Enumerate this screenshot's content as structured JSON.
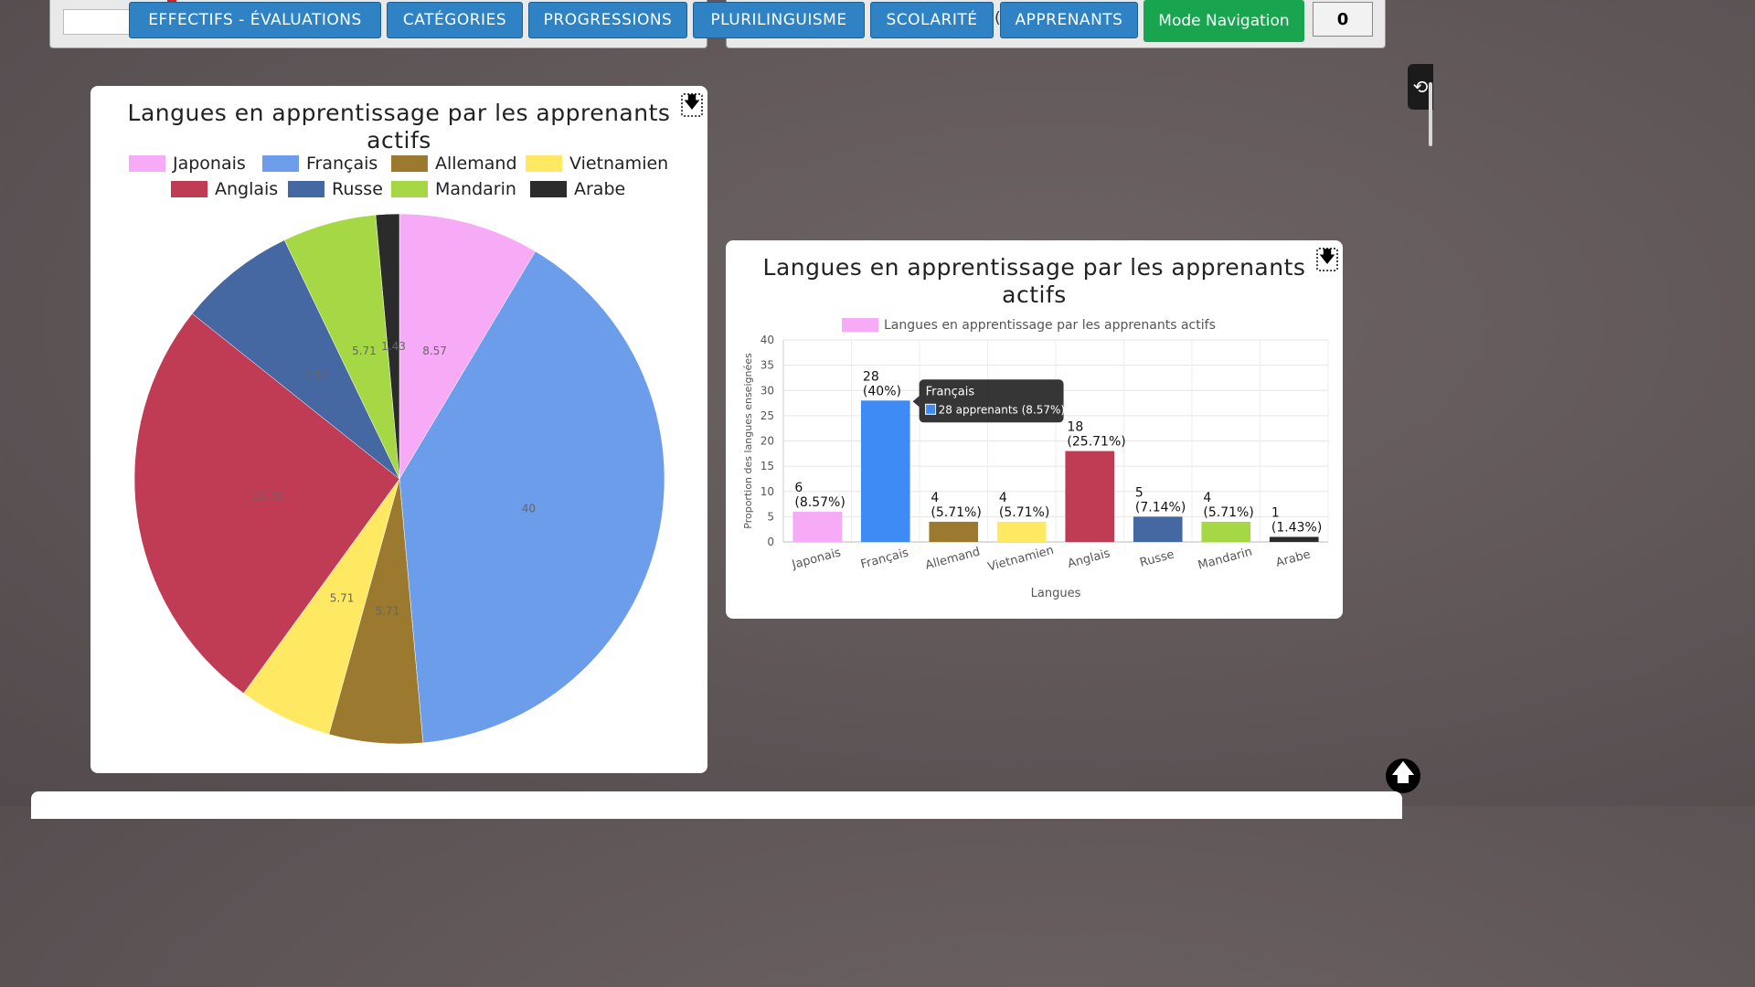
{
  "nav": {
    "buttons": [
      {
        "label": "EFFECTIFS - ÉVALUATIONS"
      },
      {
        "label": "CATÉGORIES"
      },
      {
        "label": "PROGRESSIONS"
      },
      {
        "label": "PLURILINGUISME"
      },
      {
        "label": "SCOLARITÉ"
      },
      {
        "label": "APPRENANTS"
      }
    ],
    "mode_label": "Mode Navigation",
    "counter": "0",
    "paren": "("
  },
  "colors": {
    "nav_blue": "#2f83c4",
    "mode_green": "#19a44f"
  },
  "icons": {
    "download": "download-icon",
    "history": "history-icon",
    "scroll_top": "arrow-up-icon"
  },
  "pie_card": {
    "title_line1": "Langues en apprentissage par les apprenants",
    "title_line2": "actifs"
  },
  "bar_card": {
    "title_line1": "Langues en apprentissage par les apprenants",
    "title_line2": "actifs",
    "legend_label": "Langues en apprentissage par les apprenants actifs",
    "tooltip_title": "Français",
    "tooltip_body": "28 apprenants (8.57%)"
  },
  "chart_data": [
    {
      "type": "pie",
      "title": "Langues en apprentissage par les apprenants actifs",
      "legend": "top",
      "categories": [
        "Japonais",
        "Français",
        "Allemand",
        "Vietnamien",
        "Anglais",
        "Russe",
        "Mandarin",
        "Arabe"
      ],
      "values": [
        8.57,
        40,
        5.71,
        5.71,
        25.71,
        7.14,
        5.71,
        1.43
      ],
      "labels": [
        "8.57",
        "40",
        "5.71",
        "5.71",
        "25.71",
        "7.14",
        "5.71",
        "1.43"
      ],
      "colors": [
        "#f7aaf5",
        "#6c9deb",
        "#9b7a2f",
        "#ffe963",
        "#c03c54",
        "#4668a2",
        "#a6d846",
        "#2b2b2b"
      ]
    },
    {
      "type": "bar",
      "title": "Langues en apprentissage par les apprenants actifs",
      "legend": "top",
      "categories": [
        "Japonais",
        "Français",
        "Allemand",
        "Vietnamien",
        "Anglais",
        "Russe",
        "Mandarin",
        "Arabe"
      ],
      "series": [
        {
          "name": "Langues en apprentissage par les apprenants actifs",
          "values": [
            6,
            28,
            4,
            4,
            18,
            5,
            4,
            1
          ]
        }
      ],
      "value_labels": [
        "6",
        "28",
        "4",
        "4",
        "18",
        "5",
        "4",
        "1"
      ],
      "pct_labels": [
        "(8.57%)",
        "(40%)",
        "(5.71%)",
        "(5.71%)",
        "(25.71%)",
        "(7.14%)",
        "(5.71%)",
        "(1.43%)"
      ],
      "colors": [
        "#f7aaf5",
        "#3f8bf5",
        "#9b7a2f",
        "#ffe963",
        "#c03c54",
        "#4668a2",
        "#a6d846",
        "#2b2b2b"
      ],
      "xlabel": "Langues",
      "ylabel": "Proportion des langues enseignées",
      "ylim": [
        0,
        40
      ],
      "yticks": [
        0,
        5,
        10,
        15,
        20,
        25,
        30,
        35,
        40
      ],
      "grid": true
    }
  ]
}
